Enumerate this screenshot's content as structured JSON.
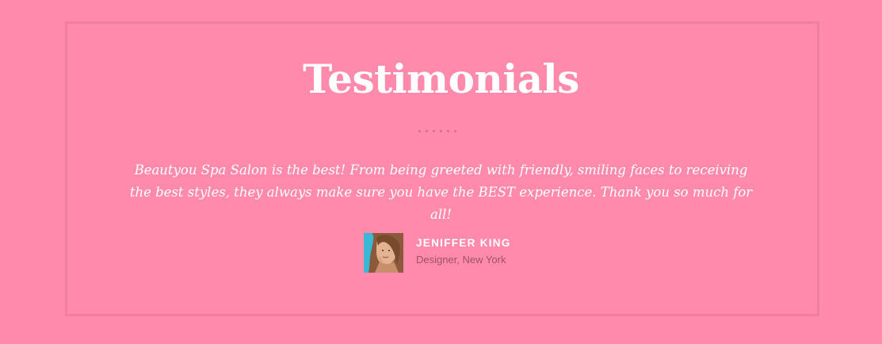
{
  "testimonials": {
    "title": "Testimonials",
    "quote": "Beautyou Spa Salon is the best! From being greeted with friendly, smiling faces to receiving the best styles, they always make sure you have the BEST experience. Thank you so much for all!",
    "author": {
      "name": "JENIFFER KING",
      "role": "Designer, New York"
    }
  },
  "colors": {
    "background": "#ff8aab",
    "frame_border": "#ee7f9d",
    "divider_dots": "#d9708c",
    "title_text": "#ffffff",
    "role_text": "#9c5366"
  },
  "icons": {
    "divider": "dotted-divider"
  }
}
